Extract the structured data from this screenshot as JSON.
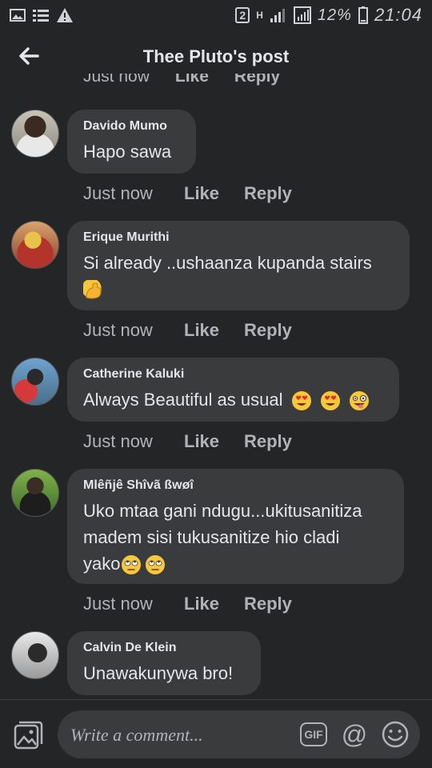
{
  "status_bar": {
    "sim_badge": "2",
    "signal_letter": "H",
    "battery_percent": "12%",
    "time": "21:04",
    "icons": [
      "image-icon",
      "list-icon",
      "warning-icon",
      "sim-icon",
      "signal-icon",
      "battery-icon"
    ]
  },
  "header": {
    "title": "Thee Pluto's post",
    "back_icon": "arrow-left-icon"
  },
  "partial_meta": {
    "time": "Just now",
    "like": "Like",
    "reply": "Reply"
  },
  "comments": [
    {
      "author": "Davido Mumo",
      "text": "Hapo sawa",
      "time": "Just now",
      "like": "Like",
      "reply": "Reply"
    },
    {
      "author": "Erique Murithi",
      "text": "Si already ..ushaanza kupanda stairs",
      "emojis": [
        "flexed-biceps-emoji"
      ],
      "time": "Just now",
      "like": "Like",
      "reply": "Reply"
    },
    {
      "author": "Catherine Kaluki",
      "text": "Always Beautiful as usual",
      "emojis": [
        "heart-eyes-emoji",
        "heart-eyes-emoji",
        "zany-face-emoji"
      ],
      "time": "Just now",
      "like": "Like",
      "reply": "Reply"
    },
    {
      "author": "Mlêñjê Shîvã ßwøî",
      "text_line1": "Uko mtaa gani ndugu...ukitusanitiza",
      "text_line2": "madem sisi tukusanitize hio cladi",
      "text_line3": "yako",
      "emojis": [
        "eye-roll-emoji",
        "eye-roll-emoji"
      ],
      "time": "Just now",
      "like": "Like",
      "reply": "Reply"
    },
    {
      "author": "Calvin De Klein",
      "text": "Unawakunywa bro!"
    }
  ],
  "composer": {
    "placeholder": "Write a comment...",
    "gif_label": "GIF",
    "at_label": "@",
    "icons": [
      "photo-icon",
      "gif-icon",
      "mention-icon",
      "emoji-icon"
    ]
  }
}
